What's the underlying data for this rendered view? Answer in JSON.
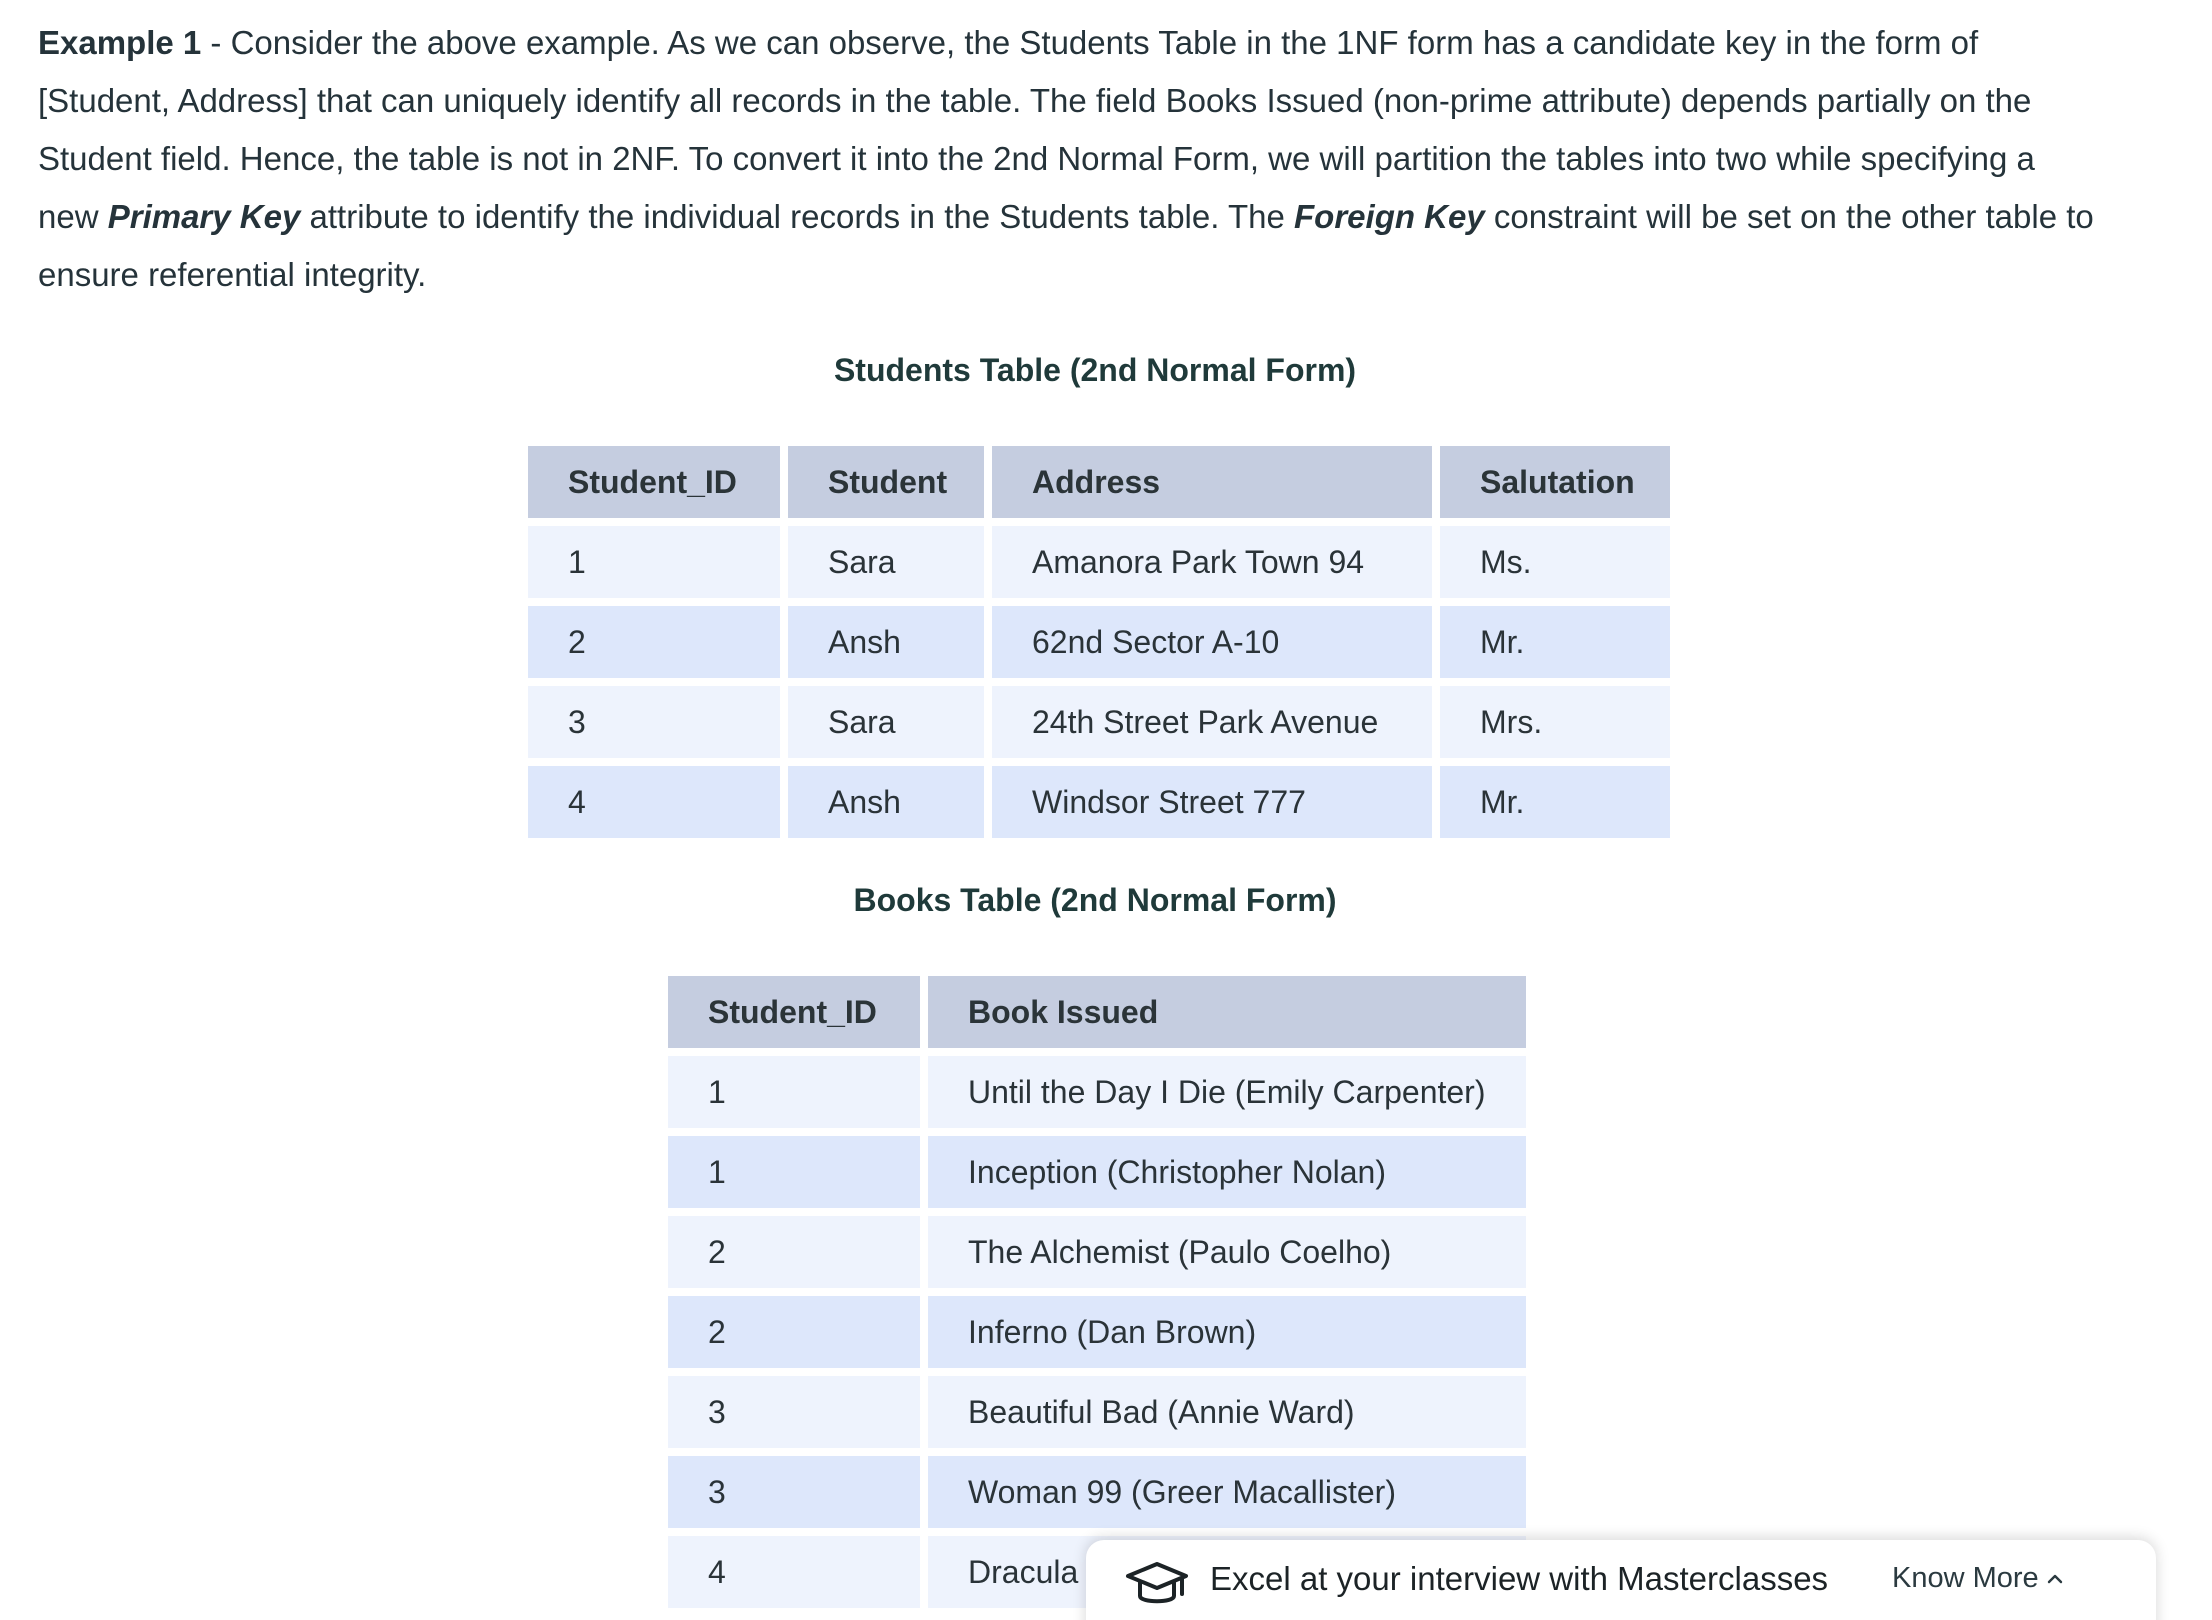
{
  "intro": {
    "lead": "Example 1",
    "part1": " - Consider the above example. As we can observe, the Students Table in the 1NF form has a candidate key in the form of [Student, Address] that can uniquely identify all records in the table. The field Books Issued (non-prime attribute) depends partially on the Student field. Hence, the table is not in 2NF. To convert it into the 2nd Normal Form, we will partition the tables into two while specifying a new ",
    "primary_key": "Primary Key",
    "part2": " attribute to identify the individual records in the Students table. The ",
    "foreign_key": "Foreign Key",
    "part3": " constraint will be set on the other table to ensure referential integrity."
  },
  "students_table": {
    "title": "Students Table (2nd Normal Form)",
    "headers": [
      "Student_ID",
      "Student",
      "Address",
      "Salutation"
    ],
    "rows": [
      [
        "1",
        "Sara",
        "Amanora Park Town 94",
        "Ms."
      ],
      [
        "2",
        "Ansh",
        "62nd Sector A-10",
        "Mr."
      ],
      [
        "3",
        "Sara",
        "24th Street Park Avenue",
        "Mrs."
      ],
      [
        "4",
        "Ansh",
        "Windsor Street 777",
        "Mr."
      ]
    ]
  },
  "books_table": {
    "title": "Books Table (2nd Normal Form)",
    "headers": [
      "Student_ID",
      "Book Issued"
    ],
    "rows": [
      [
        "1",
        "Until the Day I Die (Emily Carpenter)"
      ],
      [
        "1",
        "Inception (Christopher Nolan)"
      ],
      [
        "2",
        "The Alchemist (Paulo Coelho)"
      ],
      [
        "2",
        "Inferno (Dan Brown)"
      ],
      [
        "3",
        "Beautiful Bad (Annie Ward)"
      ],
      [
        "3",
        "Woman 99 (Greer Macallister)"
      ],
      [
        "4",
        "Dracula ("
      ]
    ]
  },
  "promo": {
    "icon": "graduation-cap-icon",
    "text": "Excel at your interview with Masterclasses",
    "link_label": "Know More",
    "link_icon": "chevron-up-icon"
  }
}
